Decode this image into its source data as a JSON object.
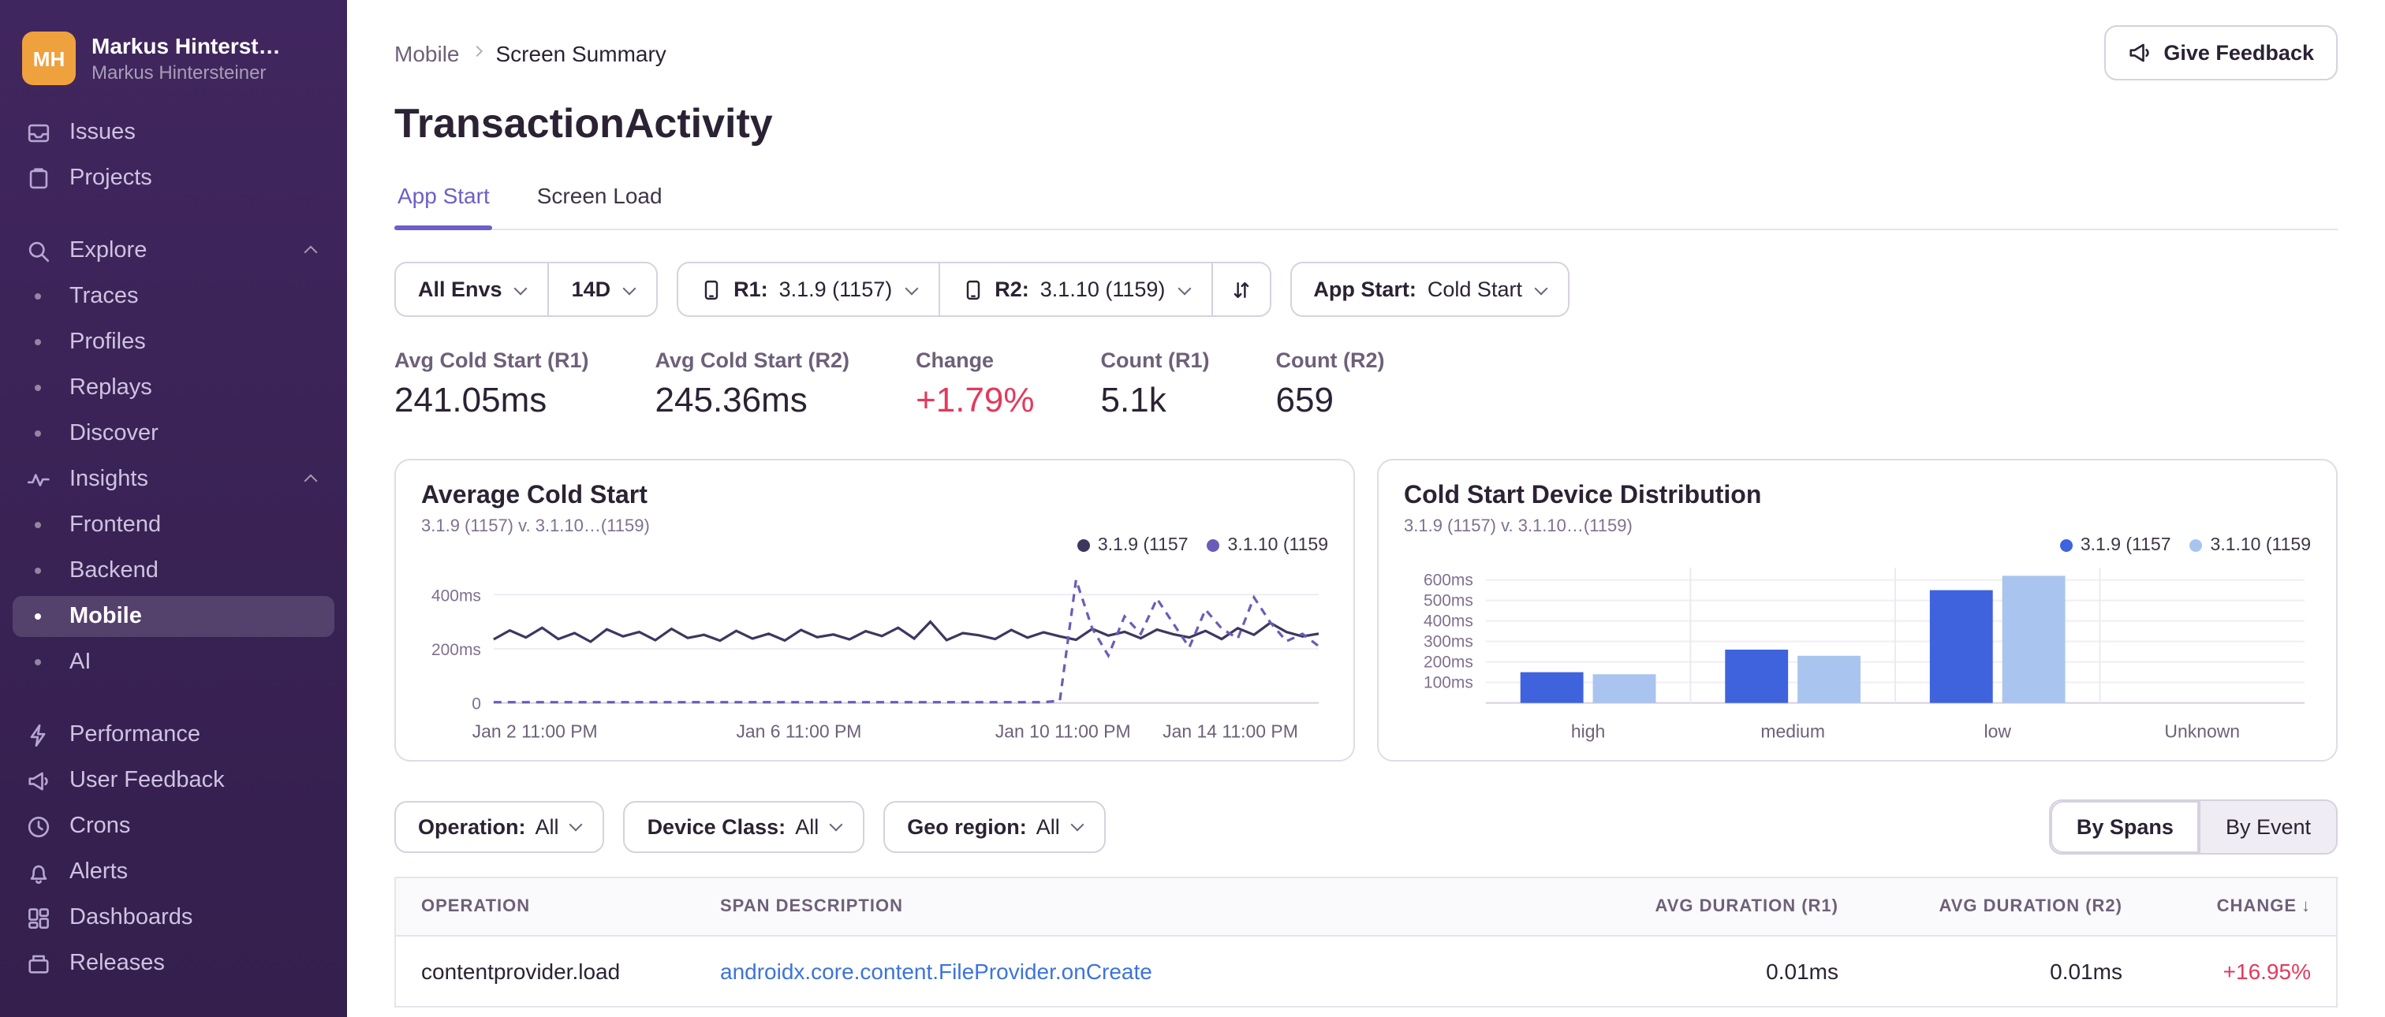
{
  "sidebar": {
    "avatar_initials": "MH",
    "org_name": "Markus Hinterst…",
    "user_name": "Markus Hintersteiner",
    "items": [
      {
        "label": "Issues",
        "icon": "issues-icon",
        "type": "top"
      },
      {
        "label": "Projects",
        "icon": "projects-icon",
        "type": "top"
      },
      {
        "label": "Explore",
        "icon": "search-icon",
        "type": "group",
        "chevron": "up",
        "spacer_before": true
      },
      {
        "label": "Traces",
        "type": "sub"
      },
      {
        "label": "Profiles",
        "type": "sub"
      },
      {
        "label": "Replays",
        "type": "sub"
      },
      {
        "label": "Discover",
        "type": "sub"
      },
      {
        "label": "Insights",
        "icon": "insights-icon",
        "type": "group",
        "chevron": "up"
      },
      {
        "label": "Frontend",
        "type": "sub"
      },
      {
        "label": "Backend",
        "type": "sub"
      },
      {
        "label": "Mobile",
        "type": "sub",
        "selected": true
      },
      {
        "label": "AI",
        "type": "sub"
      },
      {
        "label": "Performance",
        "icon": "performance-icon",
        "type": "top",
        "spacer_before": true
      },
      {
        "label": "User Feedback",
        "icon": "megaphone-icon",
        "type": "top"
      },
      {
        "label": "Crons",
        "icon": "clock-icon",
        "type": "top"
      },
      {
        "label": "Alerts",
        "icon": "bell-icon",
        "type": "top"
      },
      {
        "label": "Dashboards",
        "icon": "dashboards-icon",
        "type": "top"
      },
      {
        "label": "Releases",
        "icon": "releases-icon",
        "type": "top"
      }
    ]
  },
  "breadcrumb": {
    "items": [
      "Mobile",
      "Screen Summary"
    ]
  },
  "feedback_button": "Give Feedback",
  "page_title": "TransactionActivity",
  "tabs": [
    {
      "label": "App Start",
      "active": true
    },
    {
      "label": "Screen Load",
      "active": false
    }
  ],
  "filters": {
    "env": "All Envs",
    "range": "14D",
    "r1_label": "R1:",
    "r1_value": "3.1.9 (1157)",
    "r2_label": "R2:",
    "r2_value": "3.1.10 (1159)",
    "appstart_label": "App Start:",
    "appstart_value": "Cold Start"
  },
  "metrics": [
    {
      "label": "Avg Cold Start (R1)",
      "value": "241.05ms",
      "color": "dark"
    },
    {
      "label": "Avg Cold Start (R2)",
      "value": "245.36ms",
      "color": "dark"
    },
    {
      "label": "Change",
      "value": "+1.79%",
      "color": "red"
    },
    {
      "label": "Count (R1)",
      "value": "5.1k",
      "color": "dark"
    },
    {
      "label": "Count (R2)",
      "value": "659",
      "color": "dark"
    }
  ],
  "chart_data": [
    {
      "type": "line",
      "title": "Average Cold Start",
      "subtitle": "3.1.9 (1157) v. 3.1.10…(1159)",
      "legend": [
        {
          "label": "3.1.9 (1157",
          "color": "#3f3660"
        },
        {
          "label": "3.1.10 (1159",
          "color": "#6d5bb8"
        }
      ],
      "ylim": [
        0,
        500
      ],
      "yticks": [
        400,
        200,
        0
      ],
      "ytick_labels": [
        "400ms",
        "200ms",
        "0"
      ],
      "x_ticks": [
        "Jan 2 11:00 PM",
        "Jan 6 11:00 PM",
        "Jan 10 11:00 PM",
        "Jan 14 11:00 PM"
      ],
      "series": [
        {
          "name": "3.1.9 (1157)",
          "style": "solid",
          "color": "#3f3660",
          "values": [
            235,
            268,
            242,
            278,
            236,
            258,
            226,
            272,
            246,
            262,
            232,
            274,
            240,
            252,
            230,
            266,
            238,
            256,
            231,
            270,
            243,
            253,
            235,
            265,
            247,
            278,
            238,
            300,
            232,
            258,
            250,
            236,
            270,
            241,
            261,
            246,
            233,
            274,
            249,
            263,
            239,
            271,
            254,
            242,
            266,
            236,
            276,
            252,
            296,
            262,
            246,
            256
          ]
        },
        {
          "name": "3.1.10 (1159)",
          "style": "dashed",
          "color": "#6d5bb8",
          "values": [
            3,
            3,
            3,
            3,
            3,
            3,
            3,
            3,
            3,
            3,
            3,
            3,
            3,
            3,
            3,
            3,
            3,
            3,
            3,
            3,
            3,
            3,
            3,
            3,
            3,
            3,
            3,
            3,
            3,
            3,
            3,
            3,
            3,
            3,
            3,
            8,
            455,
            275,
            175,
            320,
            255,
            385,
            295,
            205,
            345,
            275,
            238,
            390,
            298,
            228,
            255,
            210
          ]
        }
      ]
    },
    {
      "type": "bar",
      "title": "Cold Start Device Distribution",
      "subtitle": "3.1.9 (1157) v. 3.1.10…(1159)",
      "legend": [
        {
          "label": "3.1.9 (1157",
          "color": "#3e63dd"
        },
        {
          "label": "3.1.10 (1159",
          "color": "#a9c4ee"
        }
      ],
      "categories": [
        "high",
        "medium",
        "low",
        "Unknown"
      ],
      "ylim": [
        0,
        660
      ],
      "yticks": [
        600,
        500,
        400,
        300,
        200,
        100
      ],
      "series": [
        {
          "name": "3.1.9 (1157)",
          "color": "#3e63dd",
          "values": [
            150,
            260,
            550,
            0
          ]
        },
        {
          "name": "3.1.10 (1159)",
          "color": "#a9c4ee",
          "values": [
            140,
            230,
            620,
            0
          ]
        }
      ]
    }
  ],
  "span_filters": [
    {
      "label": "Operation:",
      "value": "All"
    },
    {
      "label": "Device Class:",
      "value": "All"
    },
    {
      "label": "Geo region:",
      "value": "All"
    }
  ],
  "view_toggle": [
    {
      "label": "By Spans",
      "active": true
    },
    {
      "label": "By Event",
      "active": false
    }
  ],
  "table": {
    "headers": [
      "OPERATION",
      "SPAN DESCRIPTION",
      "AVG DURATION (R1)",
      "AVG DURATION (R2)",
      "CHANGE"
    ],
    "sorted_header": "CHANGE",
    "sort_arrow": "↓",
    "rows": [
      {
        "operation": "contentprovider.load",
        "description": "androidx.core.content.FileProvider.onCreate",
        "r1": "0.01ms",
        "r2": "0.01ms",
        "change": "+16.95%",
        "change_color": "red"
      }
    ]
  }
}
